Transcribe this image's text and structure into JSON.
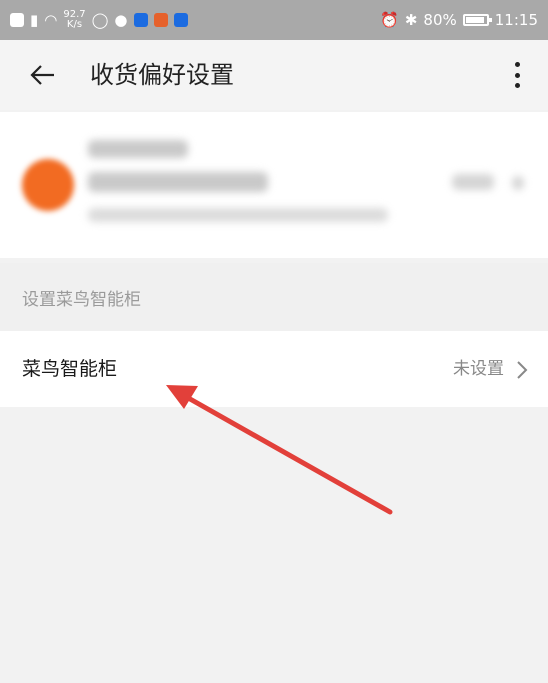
{
  "status_bar": {
    "network_speed": "92.7",
    "network_unit": "K/s",
    "battery": "80%",
    "time": "11:15"
  },
  "header": {
    "title": "收货偏好设置"
  },
  "section": {
    "label": "设置菜鸟智能柜"
  },
  "row": {
    "label": "菜鸟智能柜",
    "value": "未设置"
  },
  "colors": {
    "status_bar": "#a9a9a9",
    "avatar": "#f26b22",
    "annotation_arrow": "#e2403a"
  }
}
